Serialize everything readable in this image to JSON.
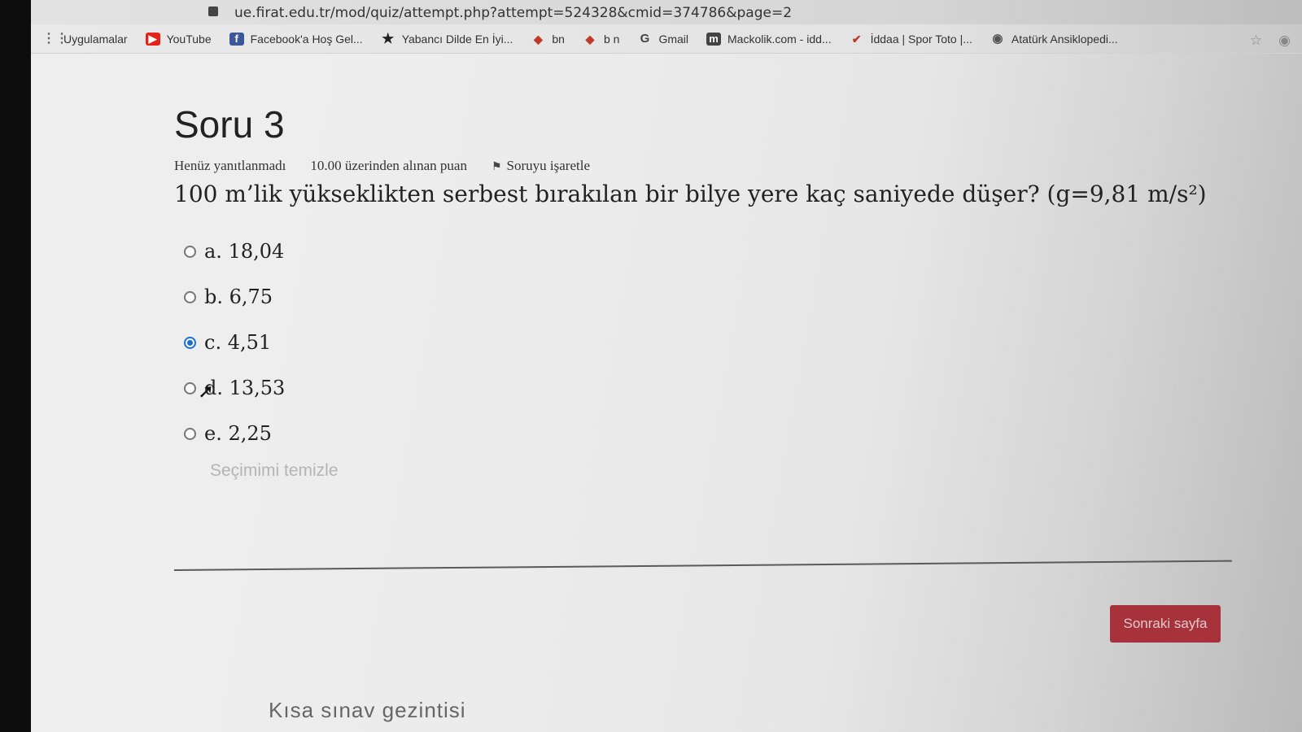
{
  "browser": {
    "url": "ue.firat.edu.tr/mod/quiz/attempt.php?attempt=524328&cmid=374786&page=2",
    "bookmarks": [
      {
        "label": "Uygulamalar",
        "icon": "apps-icon"
      },
      {
        "label": "YouTube",
        "icon": "youtube-icon"
      },
      {
        "label": "Facebook'a Hoş Gel...",
        "icon": "facebook-icon"
      },
      {
        "label": "Yabancı Dilde En İyi...",
        "icon": "star-icon"
      },
      {
        "label": "bn",
        "icon": "bookmark-icon"
      },
      {
        "label": "b n",
        "icon": "bookmark-icon"
      },
      {
        "label": "Gmail",
        "icon": "google-icon"
      },
      {
        "label": "Mackolik.com - idd...",
        "icon": "mackolik-icon"
      },
      {
        "label": "İddaa | Spor Toto |...",
        "icon": "iddaa-icon"
      },
      {
        "label": "Atatürk Ansiklopedi...",
        "icon": "globe-icon"
      }
    ]
  },
  "quiz": {
    "title": "Soru 3",
    "status": "Henüz yanıtlanmadı",
    "points": "10.00 üzerinden alınan puan",
    "flag_label": "Soruyu işaretle",
    "question_text": "100 m’lik yükseklikten serbest bırakılan bir bilye yere kaç saniyede düşer? (g=9,81 m/s²)",
    "answers": [
      {
        "label": "a. 18,04",
        "selected": false
      },
      {
        "label": "b. 6,75",
        "selected": false
      },
      {
        "label": "c. 4,51",
        "selected": true
      },
      {
        "label": "d. 13,53",
        "selected": false
      },
      {
        "label": "e. 2,25",
        "selected": false
      }
    ],
    "clear_label": "Seçimimi temizle",
    "next_button": "Sonraki sayfa",
    "nav_heading": "Kısa sınav gezintisi"
  },
  "colors": {
    "next_button": "#a8323b",
    "selected_radio": "#1c6fd1"
  }
}
